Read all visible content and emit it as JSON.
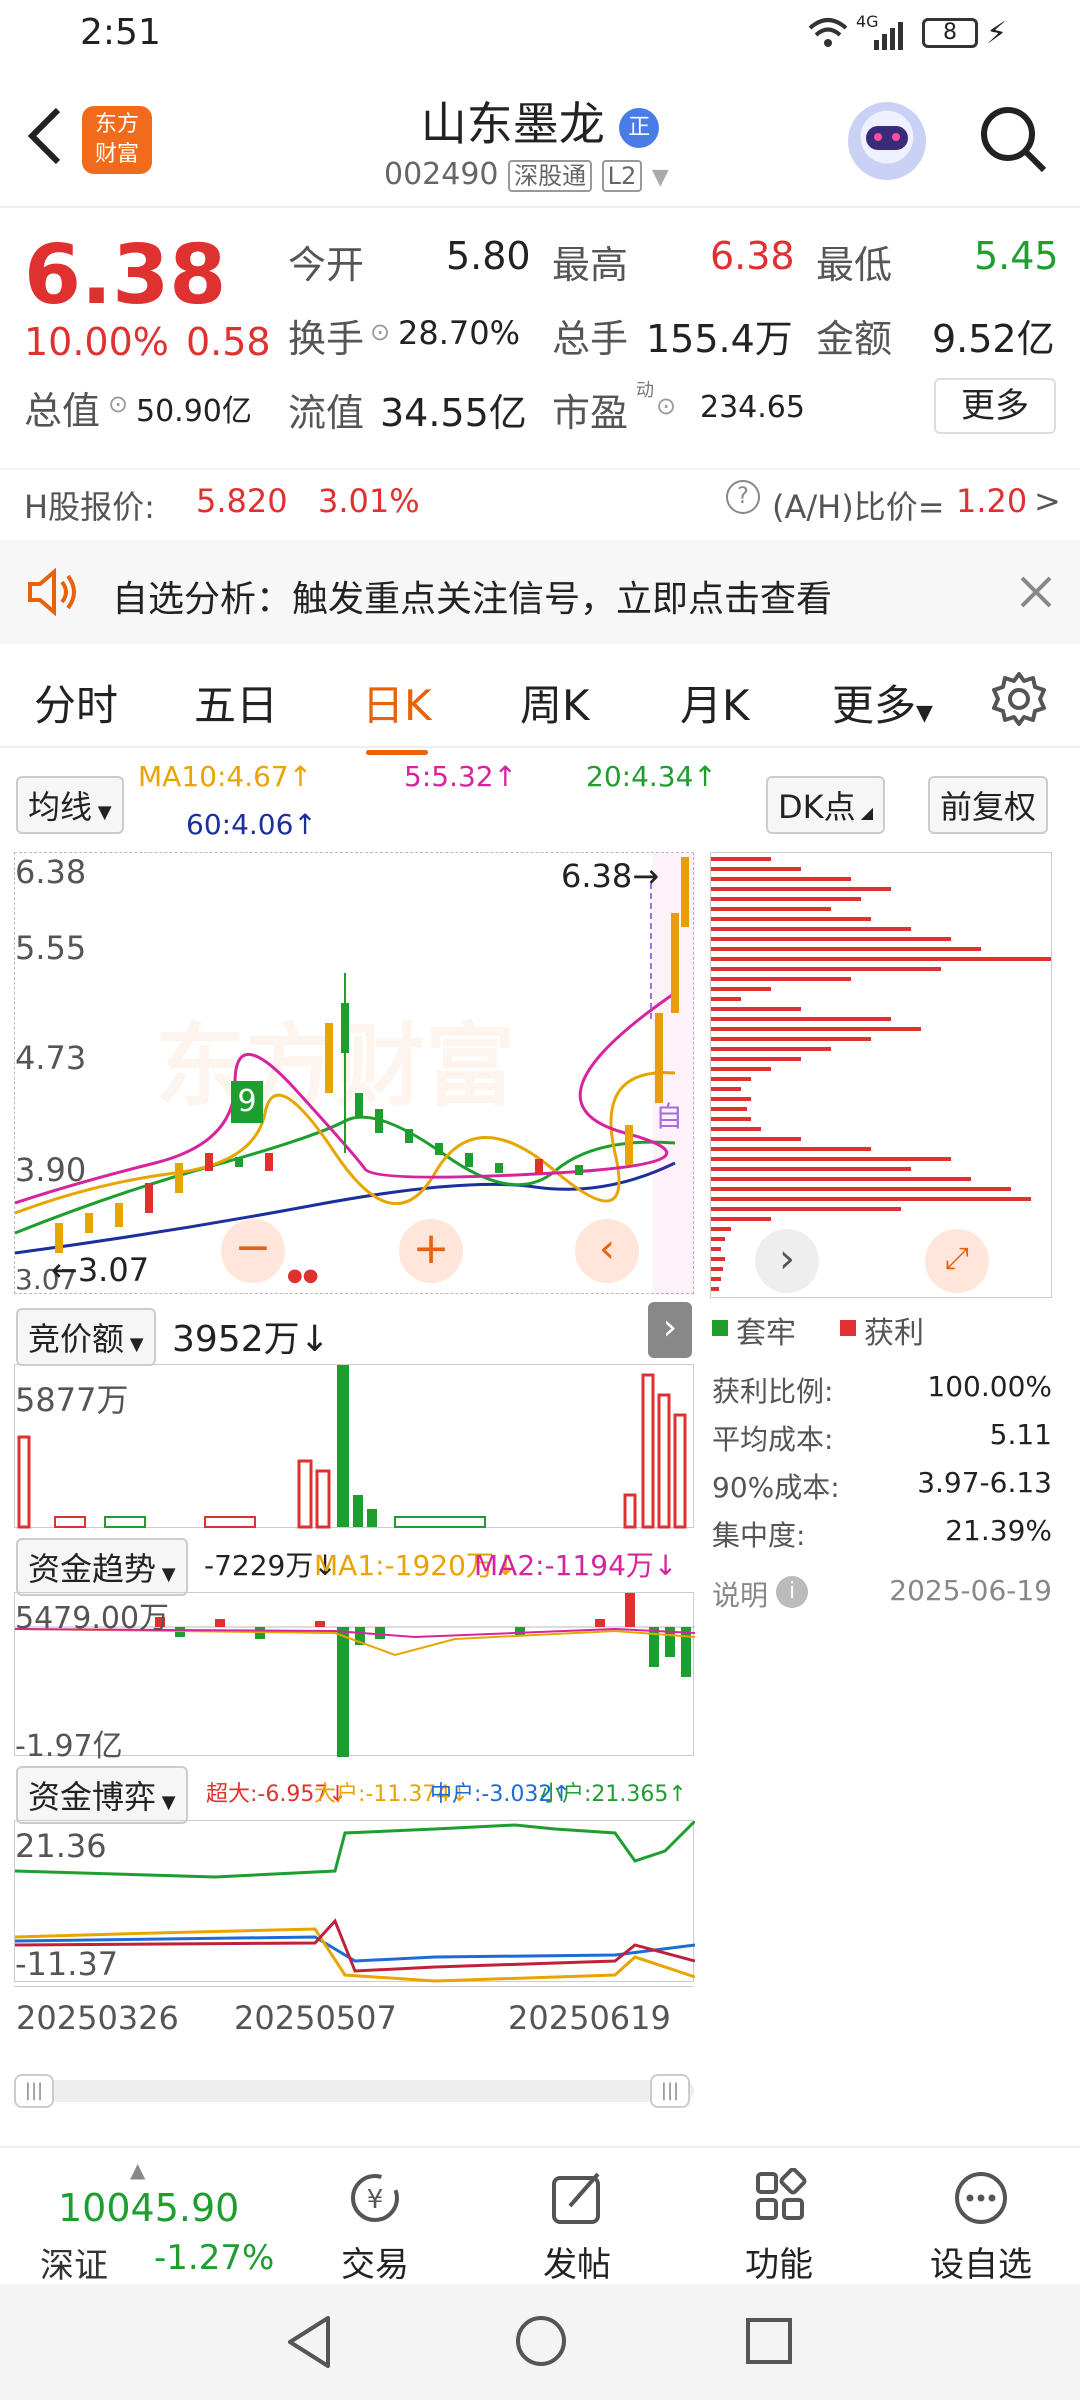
{
  "status": {
    "time": "2:51",
    "network": "4G",
    "battery": "8"
  },
  "header": {
    "title": "山东墨龙",
    "badge": "正",
    "code": "002490",
    "tag_connect": "深股通",
    "tag_level": "L2"
  },
  "quote": {
    "price": "6.38",
    "pct": "10.00%",
    "chg": "0.58",
    "open_label": "今开",
    "open": "5.80",
    "high_label": "最高",
    "high": "6.38",
    "low_label": "最低",
    "low": "5.45",
    "turnover_label": "换手",
    "turnover": "28.70%",
    "volume_label": "总手",
    "volume": "155.4万",
    "amount_label": "金额",
    "amount": "9.52亿",
    "total_cap_label": "总值",
    "total_cap": "50.90亿",
    "float_cap_label": "流值",
    "float_cap": "34.55亿",
    "pe_label": "市盈",
    "pe_sup": "动",
    "pe": "234.65",
    "more_label": "更多"
  },
  "hshare": {
    "label": "H股报价:",
    "price": "5.820",
    "pct": "3.01%",
    "ah_label": "(A/H)比价=",
    "ah_value": "1.20",
    "arrow": ">"
  },
  "banner": {
    "text": "自选分析：触发重点关注信号，立即点击查看"
  },
  "tabs": {
    "t1": "分时",
    "t2": "五日",
    "t3": "日K",
    "t4": "周K",
    "t5": "月K",
    "t6": "更多"
  },
  "ma": {
    "selector": "均线",
    "ma10": "MA10:4.67↑",
    "ma5": "5:5.32↑",
    "ma20": "20:4.34↑",
    "ma60": "60:4.06↑",
    "dk": "DK点",
    "fq": "前复权"
  },
  "kline": {
    "y1": "6.38",
    "y2": "5.55",
    "y3": "4.73",
    "y4": "3.90",
    "y5": "3.07",
    "max_label": "6.38",
    "min_label": "3.07",
    "watermark": "东方财富",
    "signal": "9",
    "auto": "自"
  },
  "colors": {
    "up": "#e03131",
    "down": "#1e9e2e",
    "orange": "#e8620c",
    "ma5": "#d6249f",
    "ma10": "#e8a400",
    "ma20": "#1e9e2e",
    "ma60": "#1c2f9e"
  },
  "auction": {
    "selector": "竞价额",
    "value": "3952万↓",
    "max": "5877万"
  },
  "fund": {
    "selector": "资金趋势",
    "value": "-7229万↓",
    "ma1": "MA1:-1920万↓",
    "ma2": "MA2:-1194万↓",
    "top": "5479.00万",
    "bottom": "-1.97亿"
  },
  "game": {
    "selector": "资金博弈",
    "super": "超大:-6.957↓",
    "big": "大户:-11.374↓",
    "mid": "中户:-3.032↑",
    "small": "小户:21.365↑",
    "top": "21.36",
    "bottom": "-11.37"
  },
  "dates": {
    "d1": "20250326",
    "d2": "20250507",
    "d3": "20250619"
  },
  "chips": {
    "legend_trap": "套牢",
    "legend_profit": "获利",
    "ratio_label": "获利比例:",
    "ratio": "100.00%",
    "avg_label": "平均成本:",
    "avg": "5.11",
    "cost90_label": "90%成本:",
    "cost90": "3.97-6.13",
    "conc_label": "集中度:",
    "conc": "21.39%",
    "note_label": "说明",
    "date": "2025-06-19"
  },
  "bottom_nav": {
    "index_value": "10045.90",
    "index_name": "深证",
    "index_pct": "-1.27%",
    "trade": "交易",
    "post": "发帖",
    "func": "功能",
    "watch": "设自选"
  }
}
